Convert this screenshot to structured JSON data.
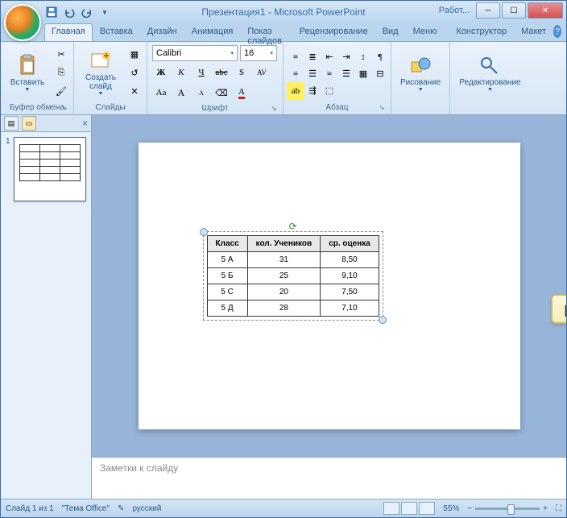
{
  "title": "Презентация1 - Microsoft PowerPoint",
  "extra_tab": "Работ...",
  "tabs": [
    "Главная",
    "Вставка",
    "Дизайн",
    "Анимация",
    "Показ слайдов",
    "Рецензирование",
    "Вид",
    "Меню",
    "Конструктор",
    "Макет"
  ],
  "ribbon": {
    "clipboard": {
      "paste": "Вставить",
      "label": "Буфер обмена"
    },
    "slides": {
      "new": "Создать\nслайд",
      "label": "Слайды"
    },
    "font": {
      "name": "Calibri",
      "size": "16",
      "label": "Шрифт"
    },
    "para": {
      "label": "Абзац"
    },
    "drawing": {
      "btn": "Рисование",
      "label": ""
    },
    "editing": {
      "btn": "Редактирование",
      "label": ""
    }
  },
  "thumbnail_number": "1",
  "table": {
    "headers": [
      "Класс",
      "кол. Учеников",
      "ср. оценка"
    ],
    "rows": [
      [
        "5 А",
        "31",
        "8,50"
      ],
      [
        "5 Б",
        "25",
        "9,10"
      ],
      [
        "5 С",
        "20",
        "7,50"
      ],
      [
        "5 Д",
        "28",
        "7,10"
      ]
    ]
  },
  "paste_tooltip": "paste",
  "notes_placeholder": "Заметки к слайду",
  "status": {
    "slide": "Слайд 1 из 1",
    "theme": "\"Тема Office\"",
    "lang": "русский",
    "zoom": "55%"
  }
}
